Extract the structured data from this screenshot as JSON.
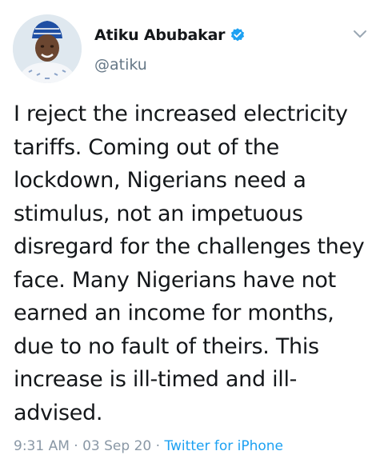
{
  "tweet": {
    "author": {
      "display_name": "Atiku Abubakar",
      "handle": "@atiku",
      "verified": true,
      "avatar": "profile-photo"
    },
    "text": "I reject the increased electricity tariffs. Coming out of the lockdown, Nigerians need a stimulus, not an impetuous disregard for the challenges they face. Many Nigerians have not earned an income for months, due to no fault of theirs. This increase is ill-timed and ill-advised.",
    "time": "9:31 AM",
    "separator": "·",
    "date": "03 Sep 20",
    "source": "Twitter for iPhone",
    "menu_icon": "chevron-down-icon"
  },
  "colors": {
    "text": "#14171a",
    "secondary": "#657786",
    "meta": "#8a98a6",
    "accent": "#1da1f2"
  }
}
